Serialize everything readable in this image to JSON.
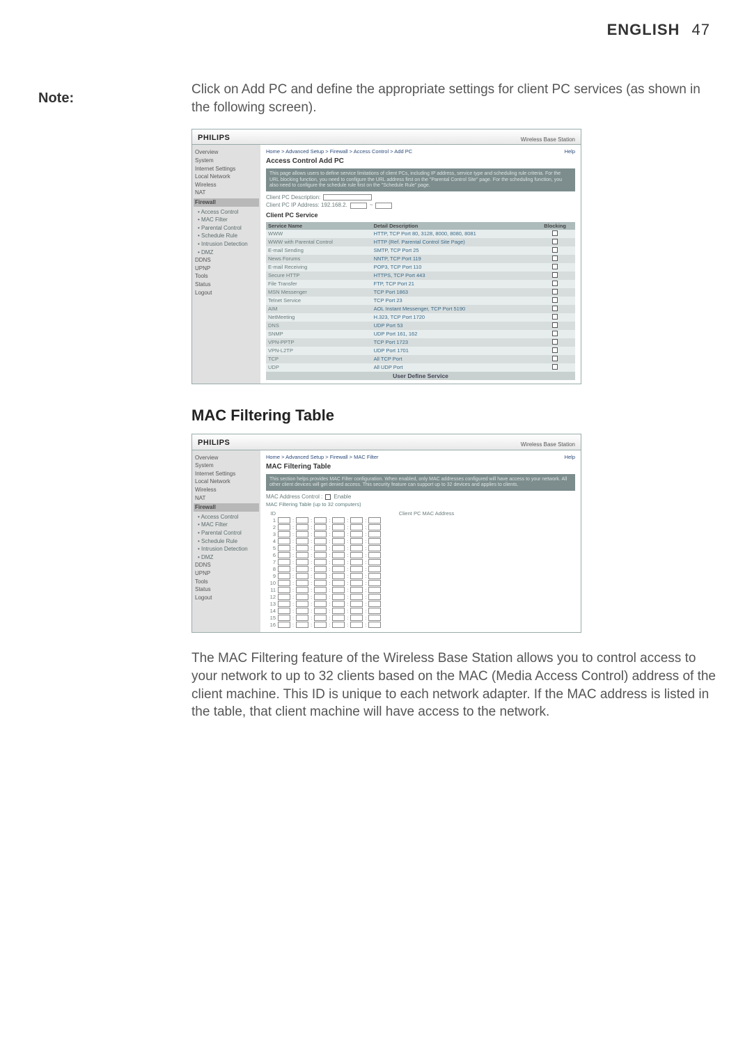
{
  "header": {
    "lang": "ENGLISH",
    "page": "47"
  },
  "left_note": "Note:",
  "para_add_pc": "Click on Add PC and define the appropriate settings for client PC services (as shown in the following screen).",
  "section_mac": "MAC Filtering Table",
  "para_mac": "The MAC Filtering feature of the Wireless Base Station allows you to control access to your network to up to 32 clients based on the MAC (Media Access Control) address of the client machine. This ID is unique to each network adapter. If the MAC address is listed in the table, that client machine will have access to the network.",
  "panel_common": {
    "logo": "PHILIPS",
    "corner": "Wireless Base Station",
    "help": "Help",
    "sidebar": [
      {
        "t": "Overview"
      },
      {
        "t": "System"
      },
      {
        "t": "Internet Settings"
      },
      {
        "t": "Local Network"
      },
      {
        "t": "Wireless"
      },
      {
        "t": "NAT"
      },
      {
        "t": "Firewall",
        "h": true
      },
      {
        "t": "Access Control",
        "s": true
      },
      {
        "t": "MAC Filter",
        "s": true
      },
      {
        "t": "Parental Control",
        "s": true
      },
      {
        "t": "Schedule Rule",
        "s": true
      },
      {
        "t": "Intrusion Detection",
        "s": true
      },
      {
        "t": "DMZ",
        "s": true
      },
      {
        "t": "DDNS"
      },
      {
        "t": "UPNP"
      },
      {
        "t": "Tools"
      },
      {
        "t": "Status"
      },
      {
        "t": "Logout"
      }
    ]
  },
  "panel_addpc": {
    "crumbs": "Home > Advanced Setup > Firewall > Access Control > Add PC",
    "title": "Access Control Add PC",
    "info": "This page allows users to define service limitations of client PCs, including IP address, service type and scheduling rule criteria. For the URL blocking function, you need to configure the URL address first on the \"Parental Control Site\" page. For the scheduling function, you also need to configure the schedule rule first on the \"Schedule Rule\" page.",
    "desc_label": "Client PC Description:",
    "ip_label": "Client PC IP Address:  192.168.2.",
    "svc_label": "Client PC Service",
    "cols": {
      "name": "Service Name",
      "detail": "Detail Description",
      "block": "Blocking"
    },
    "rows": [
      {
        "name": "WWW",
        "detail": "HTTP, TCP Port 80, 3128, 8000, 8080, 8081"
      },
      {
        "name": "WWW with Parental Control",
        "detail": "HTTP (Ref. Parental Control Site Page)"
      },
      {
        "name": "E-mail Sending",
        "detail": "SMTP, TCP Port 25"
      },
      {
        "name": "News Forums",
        "detail": "NNTP, TCP Port 119"
      },
      {
        "name": "E-mail Receiving",
        "detail": "POP3, TCP Port 110"
      },
      {
        "name": "Secure HTTP",
        "detail": "HTTPS, TCP Port 443"
      },
      {
        "name": "File Transfer",
        "detail": "FTP, TCP Port 21"
      },
      {
        "name": "MSN Messenger",
        "detail": "TCP Port 1863"
      },
      {
        "name": "Telnet Service",
        "detail": "TCP Port 23"
      },
      {
        "name": "AIM",
        "detail": "AOL Instant Messenger, TCP Port 5190"
      },
      {
        "name": "NetMeeting",
        "detail": "H.323, TCP Port 1720"
      },
      {
        "name": "DNS",
        "detail": "UDP Port 53"
      },
      {
        "name": "SNMP",
        "detail": "UDP Port 161, 162"
      },
      {
        "name": "VPN-PPTP",
        "detail": "TCP Port 1723"
      },
      {
        "name": "VPN-L2TP",
        "detail": "UDP Port 1701"
      },
      {
        "name": "TCP",
        "detail": "All TCP Port"
      },
      {
        "name": "UDP",
        "detail": "All UDP Port"
      }
    ],
    "user_define": "User Define Service"
  },
  "panel_mac": {
    "crumbs": "Home > Advanced Setup > Firewall > MAC Filter",
    "title": "MAC Filtering Table",
    "info": "This section helps provides MAC Filter configuration. When enabled, only MAC addresses configured will have access to your network. All other client devices will get denied access. This security feature can support up to 32 devices and applies to clients.",
    "ctrl_label": "MAC Address Control :",
    "enable_cb": "Enable",
    "table_title": "MAC Filtering Table (up to 32 computers)",
    "col_id": "ID",
    "col_addr": "Client PC MAC Address",
    "rows": 16
  }
}
